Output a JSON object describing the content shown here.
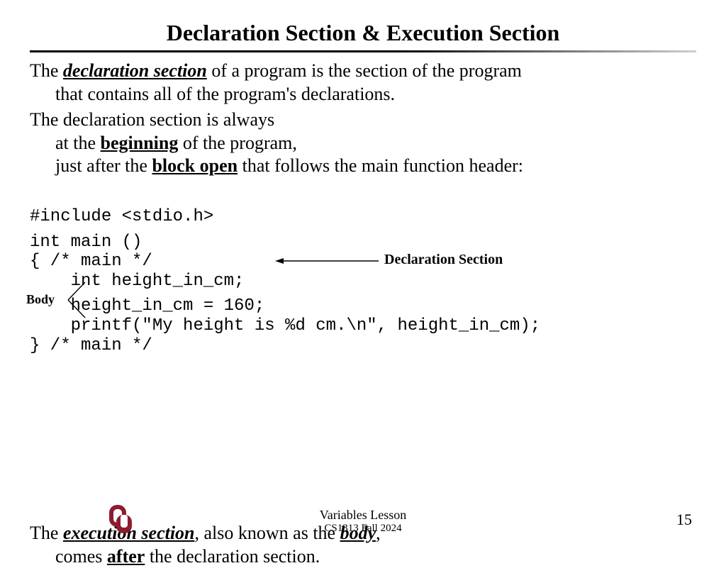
{
  "title": "Declaration Section & Execution Section",
  "p1": {
    "lead": "The ",
    "term": "declaration section",
    "rest1": " of a program is the section of the program",
    "line2": "that contains all of the program's declarations."
  },
  "p2": {
    "line1": "The declaration section is always",
    "line2a": "at the ",
    "beginning": "beginning",
    "line2b": " of the program,",
    "line3a": "just after the ",
    "blockopen": "block open",
    "line3b": " that follows the main function header:"
  },
  "code": {
    "l1": "#include <stdio.h>",
    "l2": "int main ()",
    "l3": "{ /* main */",
    "l4": "    int height_in_cm;",
    "l5": "    height_in_cm = 160;",
    "l6": "    printf(\"My height is %d cm.\\n\", height_in_cm);",
    "l7": "} /* main */"
  },
  "labels": {
    "body": "Body",
    "decl": "Declaration Section"
  },
  "p3": {
    "lead": "The ",
    "exec": "execution section",
    "mid": ", also known as the ",
    "body": "body",
    "tail": ",",
    "line2a": "comes ",
    "after": "after",
    "line2b": " the declaration section."
  },
  "footer": {
    "lesson": "Variables Lesson",
    "course": "CS1313 Fall 2024",
    "page": "15"
  }
}
